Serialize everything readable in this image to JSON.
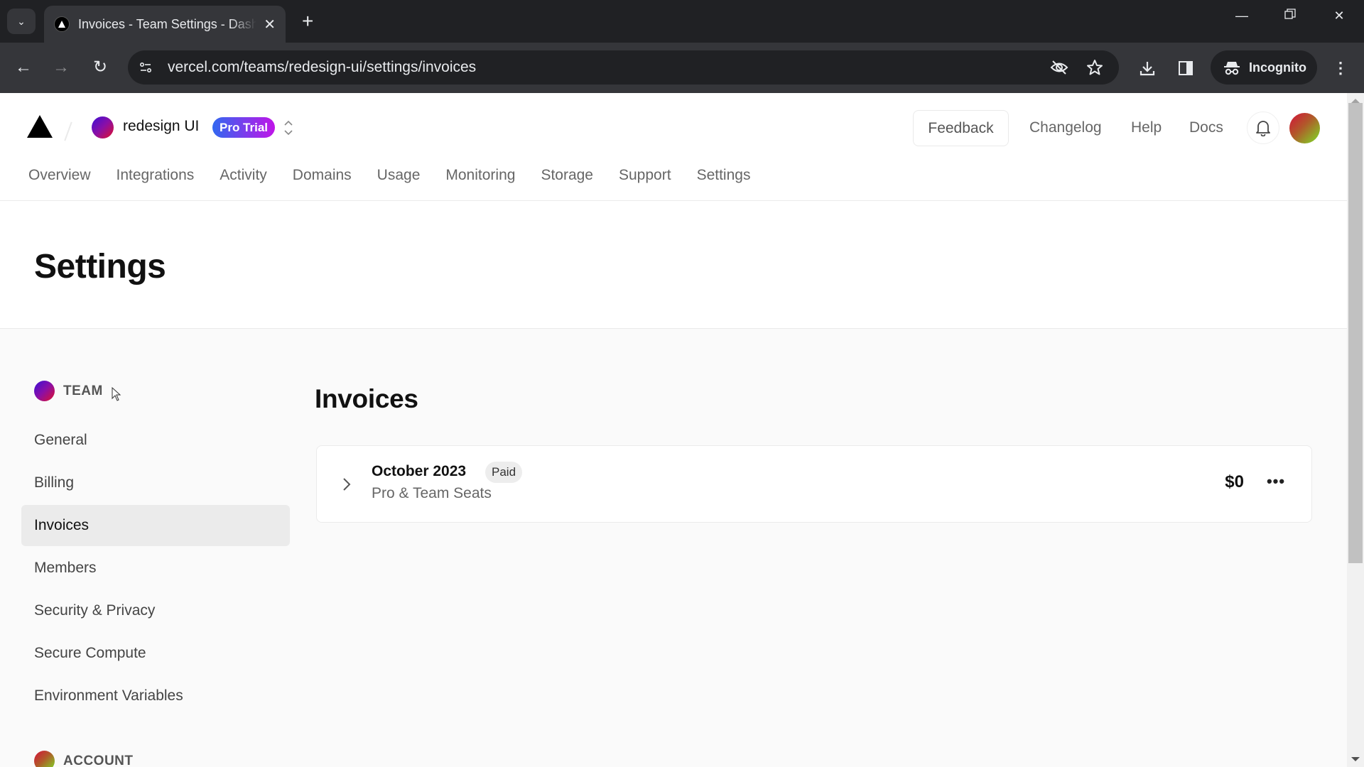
{
  "browser": {
    "tab_title": "Invoices - Team Settings - Dashboard",
    "url": "vercel.com/teams/redesign-ui/settings/invoices",
    "incognito_label": "Incognito"
  },
  "header": {
    "team_name": "redesign UI",
    "plan_badge": "Pro Trial",
    "feedback_label": "Feedback",
    "links": [
      "Changelog",
      "Help",
      "Docs"
    ]
  },
  "nav_tabs": [
    "Overview",
    "Integrations",
    "Activity",
    "Domains",
    "Usage",
    "Monitoring",
    "Storage",
    "Support",
    "Settings"
  ],
  "page_title": "Settings",
  "sidebar": {
    "team_section": "TEAM",
    "items": [
      "General",
      "Billing",
      "Invoices",
      "Members",
      "Security & Privacy",
      "Secure Compute",
      "Environment Variables"
    ],
    "active_item": "Invoices",
    "account_section": "ACCOUNT"
  },
  "invoices": {
    "heading": "Invoices",
    "rows": [
      {
        "period": "October 2023",
        "status": "Paid",
        "description": "Pro & Team Seats",
        "amount": "$0"
      }
    ]
  },
  "colors": {
    "pro_badge_start": "#3168f0",
    "pro_badge_end": "#c015e8",
    "active_sidebar_bg": "#ebebeb"
  }
}
